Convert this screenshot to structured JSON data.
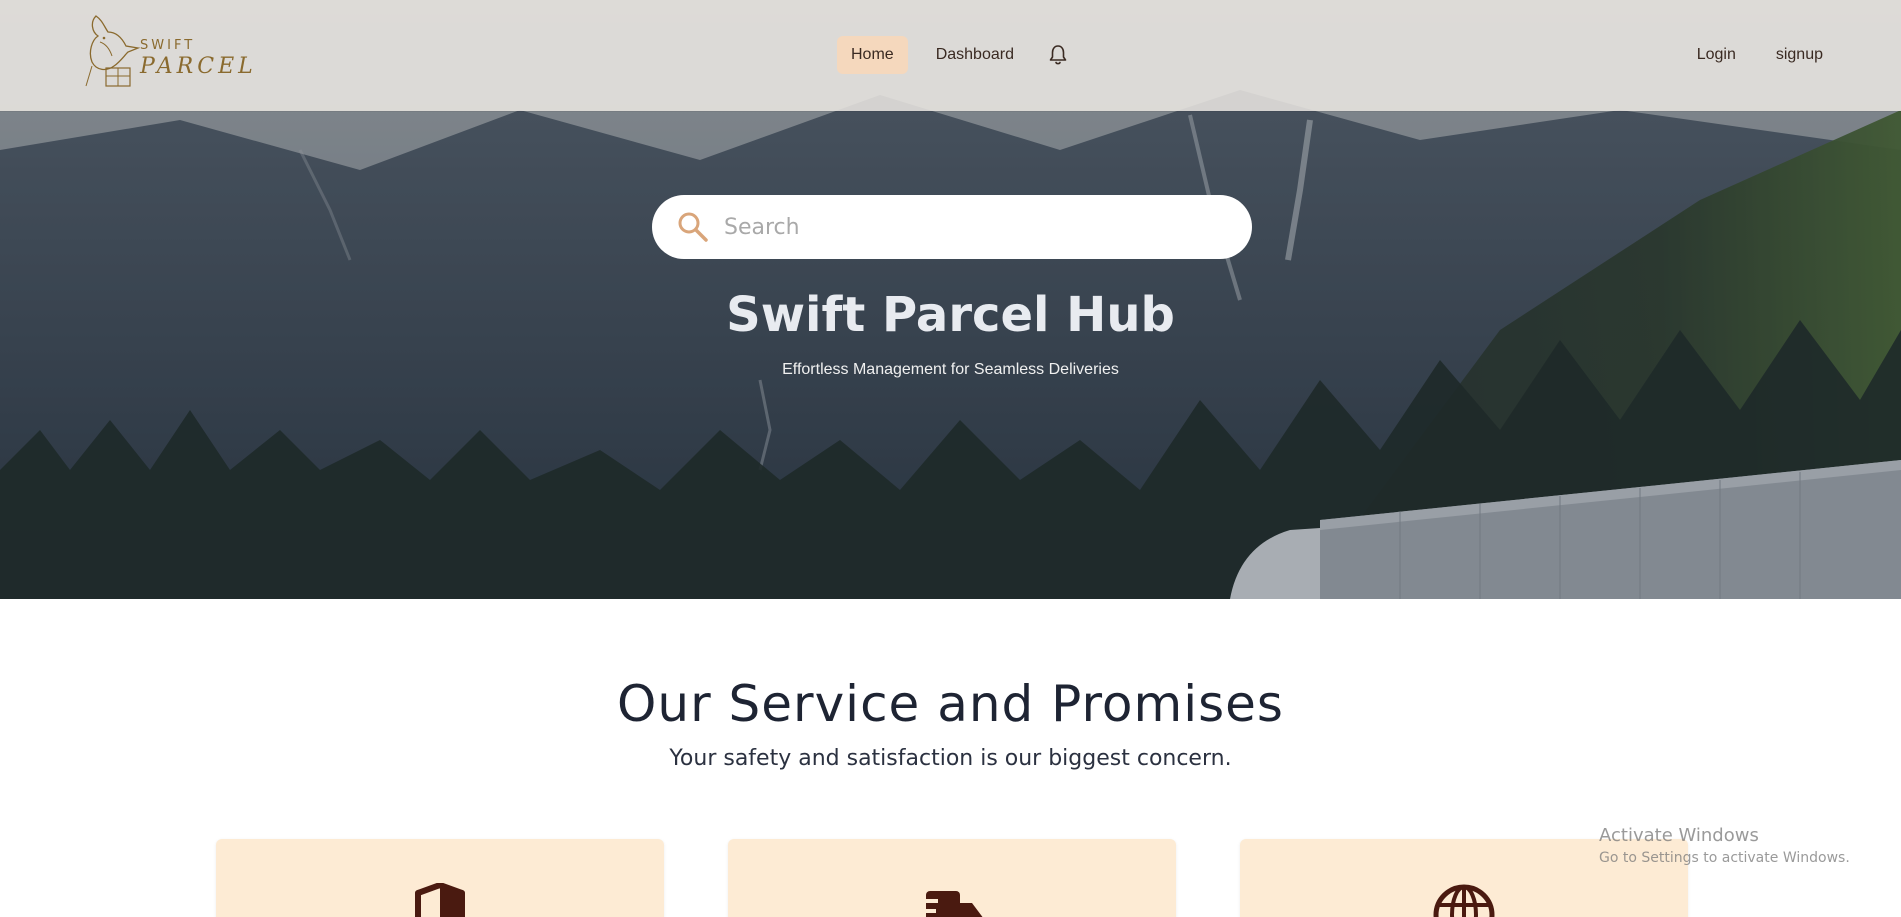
{
  "brand": {
    "line1": "SWIFT",
    "line2": "PARCEL"
  },
  "nav": {
    "home": "Home",
    "dashboard": "Dashboard",
    "login": "Login",
    "signup": "signup"
  },
  "search": {
    "placeholder": "Search"
  },
  "hero": {
    "title": "Swift Parcel Hub",
    "subtitle": "Effortless Management for Seamless Deliveries"
  },
  "services": {
    "title": "Our Service and Promises",
    "subtitle": "Your safety and satisfaction is our biggest concern.",
    "cards": [
      {
        "icon": "shield-icon"
      },
      {
        "icon": "delivery-truck-icon"
      },
      {
        "icon": "globe-icon"
      }
    ]
  },
  "watermark": {
    "title": "Activate Windows",
    "subtitle": "Go to Settings to activate Windows."
  },
  "colors": {
    "accent": "#f5d8bd",
    "card_bg": "#fdebd4",
    "icon_brown": "#4a1a10",
    "logo_gold": "#8a6a2e"
  }
}
